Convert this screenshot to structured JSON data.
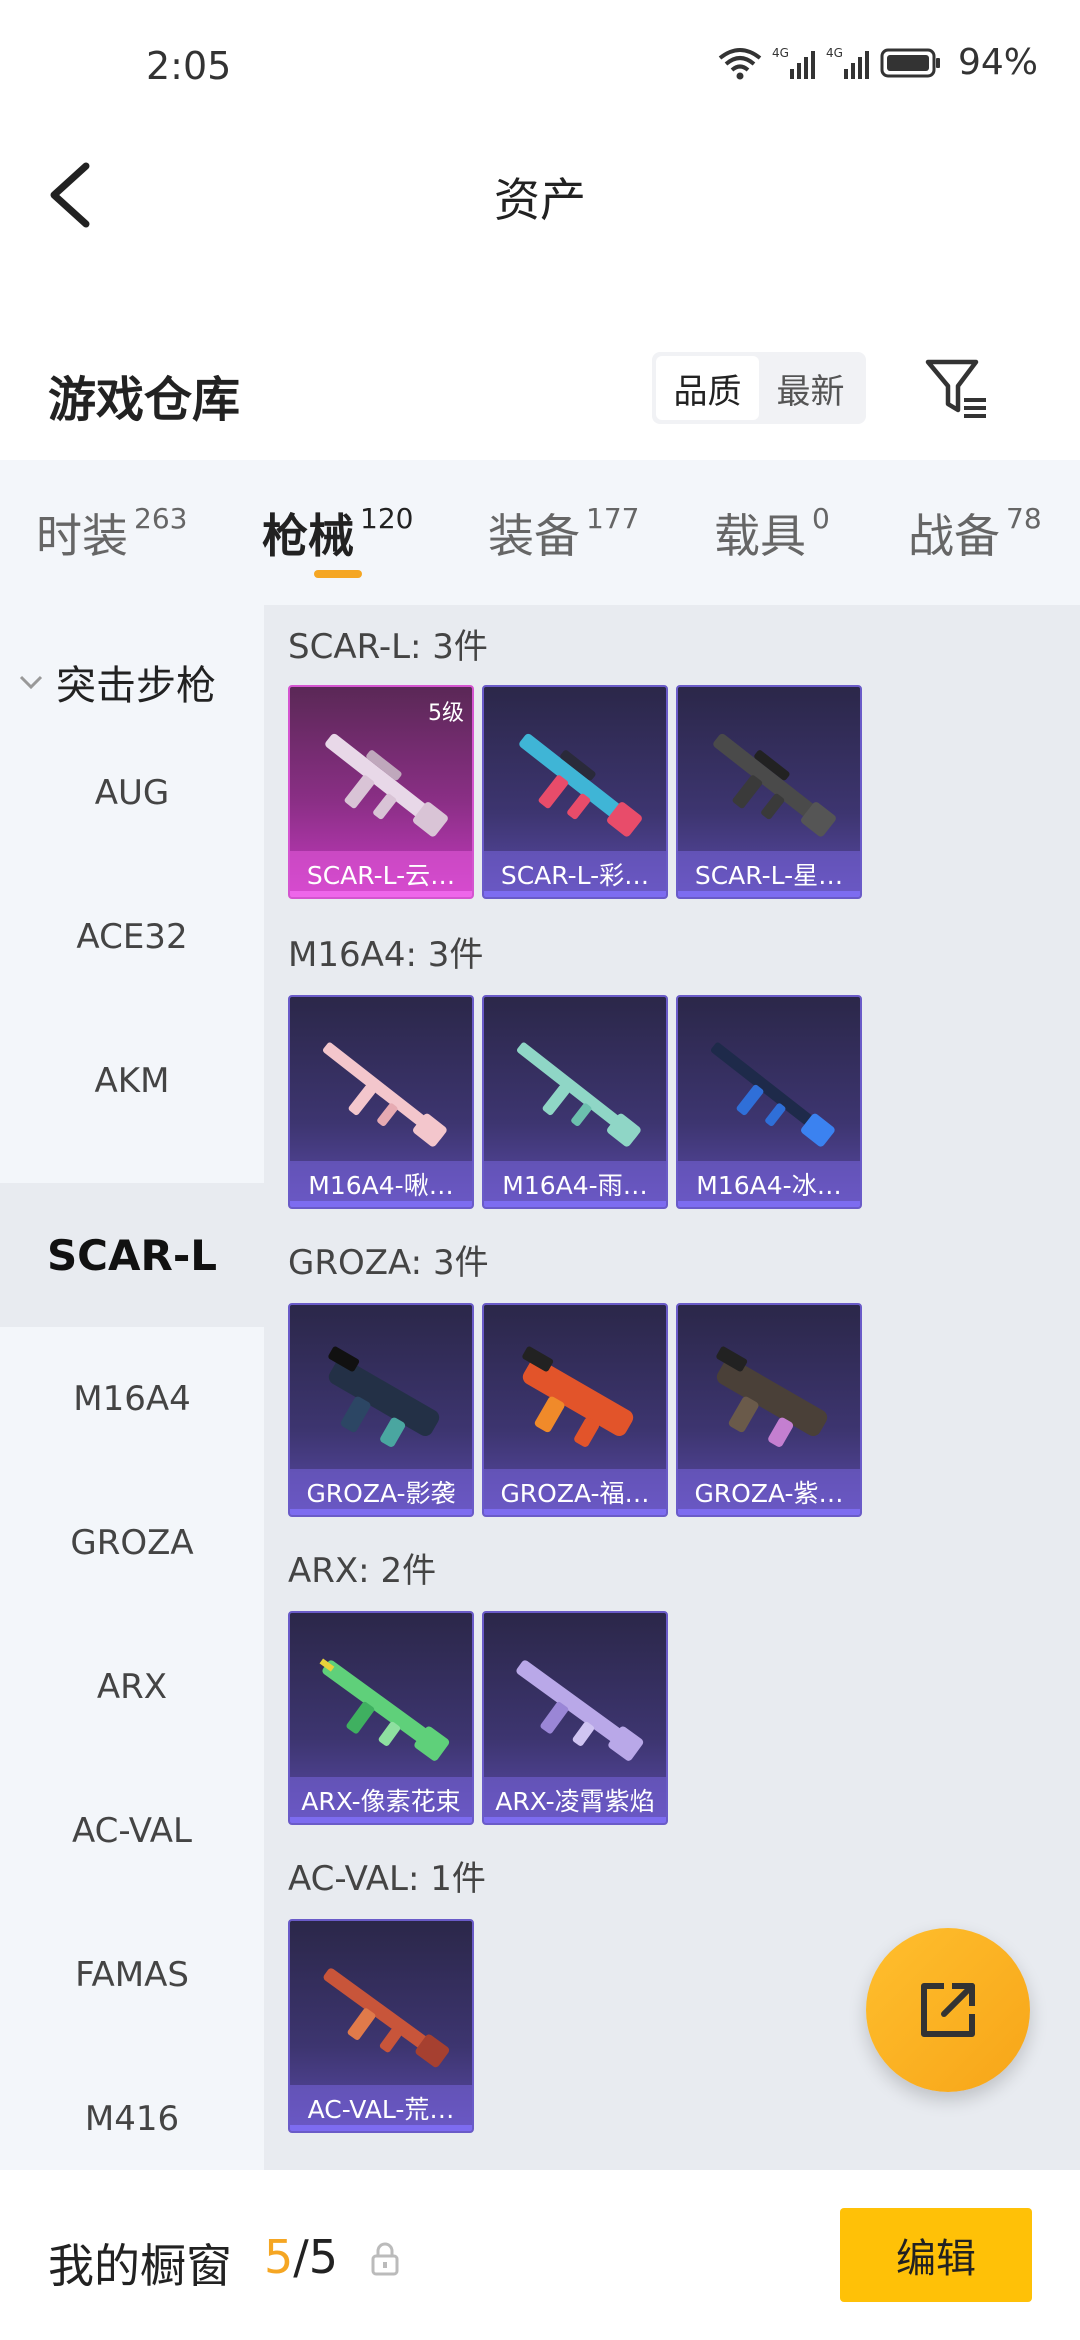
{
  "status": {
    "time": "2:05",
    "battery": "94%"
  },
  "header": {
    "title": "资产"
  },
  "section": {
    "title": "游戏仓库",
    "sort_quality": "品质",
    "sort_newest": "最新"
  },
  "tabs": [
    {
      "label": "时装",
      "count": "263"
    },
    {
      "label": "枪械",
      "count": "120"
    },
    {
      "label": "装备",
      "count": "177"
    },
    {
      "label": "载具",
      "count": "0"
    },
    {
      "label": "战备",
      "count": "78"
    }
  ],
  "sidebar": {
    "group": "突击步枪",
    "items": [
      "AUG",
      "ACE32",
      "AKM",
      "SCAR-L",
      "M16A4",
      "GROZA",
      "ARX",
      "AC-VAL",
      "FAMAS",
      "M416"
    ]
  },
  "groups": [
    {
      "title": "SCAR-L: 3件",
      "items": [
        {
          "name": "SCAR-L-云…",
          "level": "5级"
        },
        {
          "name": "SCAR-L-彩…"
        },
        {
          "name": "SCAR-L-星…"
        }
      ]
    },
    {
      "title": "M16A4: 3件",
      "items": [
        {
          "name": "M16A4-啾…"
        },
        {
          "name": "M16A4-雨…"
        },
        {
          "name": "M16A4-冰…"
        }
      ]
    },
    {
      "title": "GROZA: 3件",
      "items": [
        {
          "name": "GROZA-影袭"
        },
        {
          "name": "GROZA-福…"
        },
        {
          "name": "GROZA-紫…"
        }
      ]
    },
    {
      "title": "ARX: 2件",
      "items": [
        {
          "name": "ARX-像素花束"
        },
        {
          "name": "ARX-凌霄紫焰"
        }
      ]
    },
    {
      "title": "AC-VAL: 1件",
      "items": [
        {
          "name": "AC-VAL-荒…"
        }
      ]
    }
  ],
  "bottom": {
    "label": "我的橱窗",
    "count_current": "5",
    "count_sep": "/",
    "count_total": "5",
    "edit": "编辑"
  },
  "colors": {
    "accent": "#f5a623",
    "edit_button": "#ffc107",
    "card_purple": "#3d3570",
    "card_gold": "#8b2f86"
  }
}
